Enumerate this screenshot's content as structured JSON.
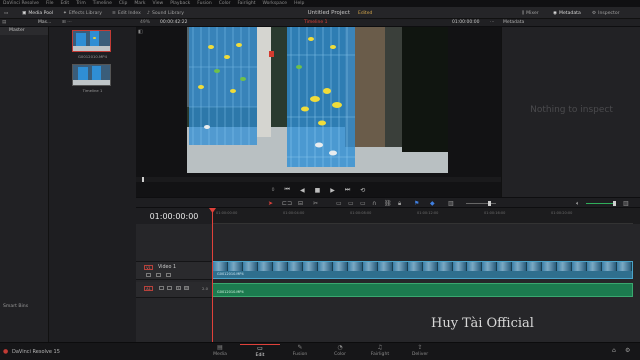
{
  "menu": [
    "DaVinci Resolve",
    "File",
    "Edit",
    "Trim",
    "Timeline",
    "Clip",
    "Mark",
    "View",
    "Playback",
    "Fusion",
    "Color",
    "Fairlight",
    "Workspace",
    "Help"
  ],
  "toolbar": {
    "media_pool": "Media Pool",
    "effects_library": "Effects Library",
    "edit_index": "Edit Index",
    "sound_library": "Sound Library",
    "project_title": "Untitled Project",
    "edited": "Edited",
    "mixer": "Mixer",
    "metadata": "Metadata",
    "inspector": "Inspector"
  },
  "header2": {
    "pool_label": "Mas...",
    "zoom": "49%",
    "source_timecode": "00:00:42:22",
    "timeline_name": "Timeline 1",
    "record_timecode": "01:00:00:00",
    "panel_title": "Metadata"
  },
  "left": {
    "master": "Master",
    "smart_bins": "Smart Bins"
  },
  "media": {
    "clip1": "G0012010.MP4",
    "clip2": "Timeline 1"
  },
  "viewer": {
    "frame_counter": "0"
  },
  "inspector": {
    "empty": "Nothing to inspect"
  },
  "timeline": {
    "timecode": "01:00:00:00",
    "ticks": [
      "01:00:00:00",
      "01:00:04:00",
      "01:00:08:00",
      "01:00:12:00",
      "01:00:16:00",
      "01:00:20:00"
    ],
    "video_track": {
      "id": "V1",
      "name": "Video 1",
      "clip": "G0012010.MP4"
    },
    "audio_track": {
      "id": "A1",
      "level": "2.0",
      "clip": "G0012010.MP4"
    }
  },
  "watermark": "Huy Tài Official",
  "app_name": "DaVinci Resolve 15",
  "pages": [
    "Media",
    "Edit",
    "Fusion",
    "Color",
    "Fairlight",
    "Deliver"
  ],
  "colors": {
    "playhead": "#e0413a",
    "video_clip": "#2f6f8e",
    "audio_clip": "#1c7b4f",
    "accent_edited": "#d3a54a"
  }
}
